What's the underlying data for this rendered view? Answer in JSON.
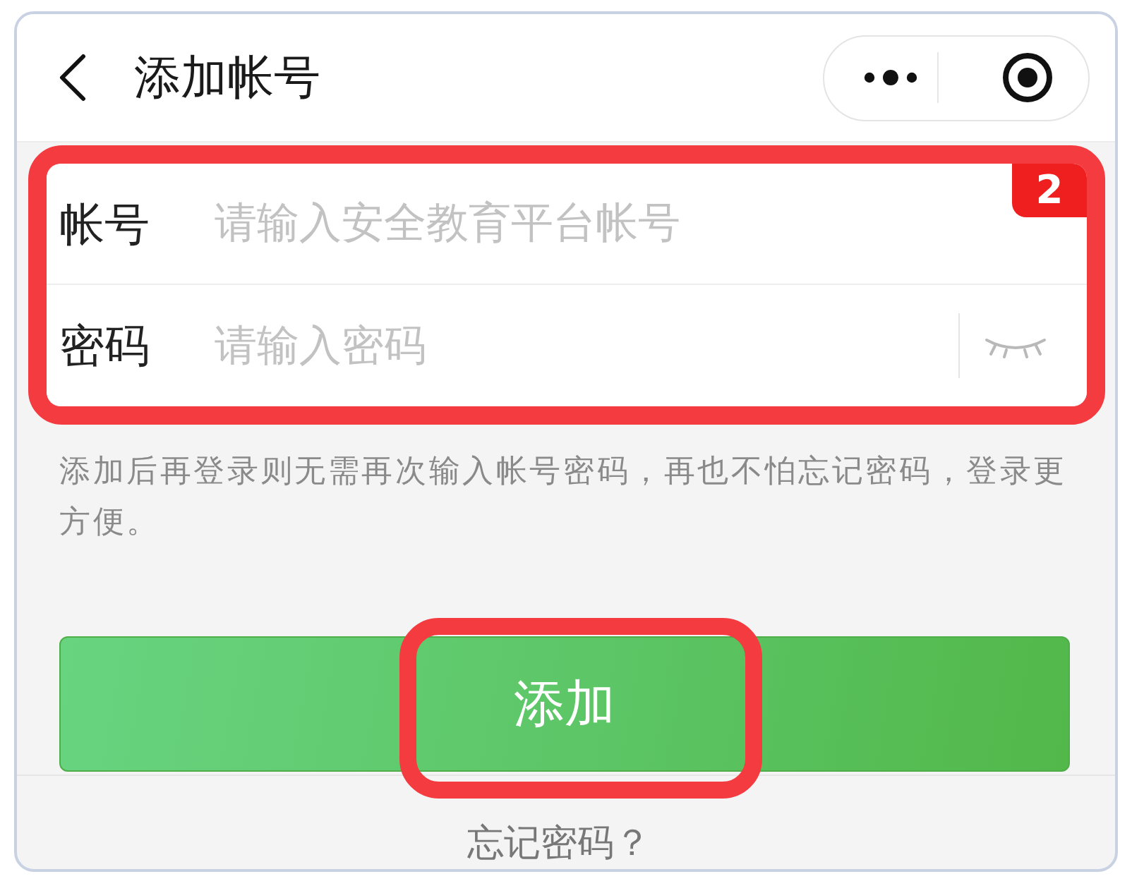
{
  "header": {
    "title": "添加帐号"
  },
  "form": {
    "highlighted": true,
    "step_badge": "2",
    "fields": [
      {
        "kind": "text",
        "label": "帐号",
        "placeholder": "请输入安全教育平台帐号"
      },
      {
        "kind": "password",
        "label": "密码",
        "placeholder": "请输入密码",
        "password_visible": false
      }
    ]
  },
  "hint": "添加后再登录则无需再次输入帐号密码，再也不怕忘记密码，登录更方便。",
  "add_button": {
    "label": "添加",
    "highlighted": true
  },
  "forgot_link": "忘记密码？"
}
